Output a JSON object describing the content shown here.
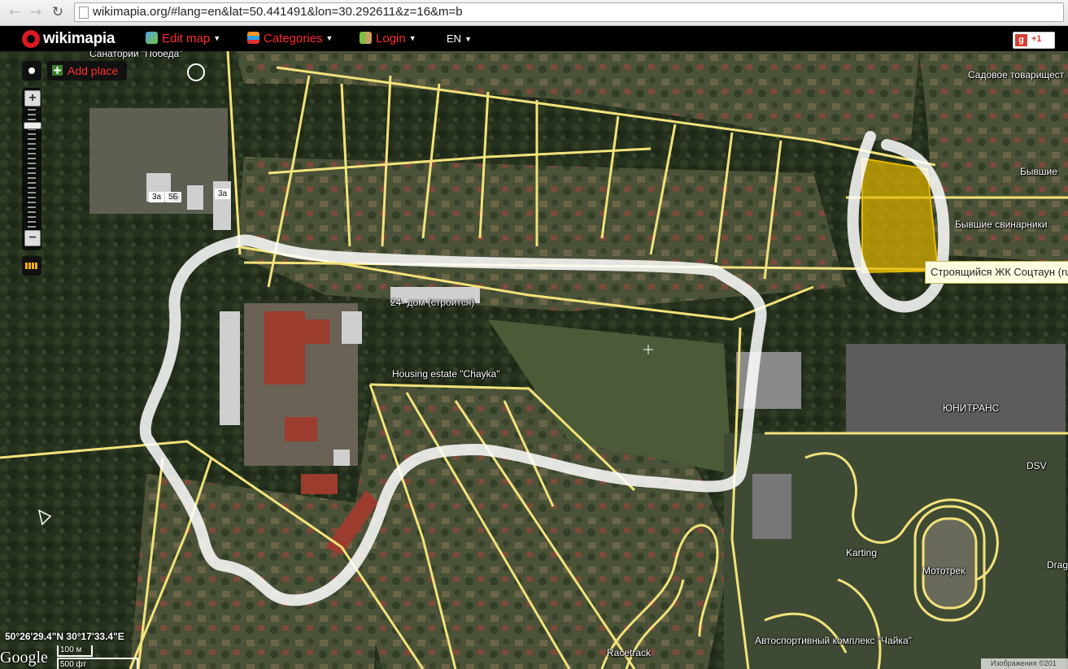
{
  "browser": {
    "url": "wikimapia.org/#lang=en&lat=50.441491&lon=30.292611&z=16&m=b",
    "back_icon": "arrow-left-icon",
    "forward_icon": "arrow-right-icon",
    "reload_icon": "reload-icon"
  },
  "toolbar": {
    "logo_text": "wikimapia",
    "edit_map": "Edit map",
    "categories": "Categories",
    "login": "Login",
    "language": "EN",
    "gplus_g": "g",
    "gplus_count": "+1"
  },
  "controls": {
    "add_place": "Add place",
    "zoom_in": "+",
    "zoom_out": "−",
    "zoom_level": 16
  },
  "map": {
    "labels": {
      "sanatorium": "Санатории \"Победа\"",
      "garden_society": "Садовое товарищест",
      "former_top": "Бывшие ",
      "former_pigsties": "Бывшие свинарники",
      "building_3a_left": "3a",
      "building_5b": "5Б",
      "building_3a_right": "3a",
      "house_24": "24- дом (строится)",
      "housing_estate": "Housing estate \"Chayka\"",
      "unitrans": "ЮНИТРАНС",
      "dsv": "DSV",
      "karting": "Karting",
      "motortrack": "Мототрек",
      "drag": "Drag",
      "racetrack": "Racetrack",
      "autosport_complex": "Автоспортивный комплекс \"Чайка\""
    },
    "hover_label": "Строящийся ЖК Соцтаун (ru",
    "highlight_color": "#e6b800",
    "road_color": "#f2e27a",
    "route_color": "#ffffff"
  },
  "footer": {
    "coordinates": "50°26'29.4\"N 30°17'33.4\"E",
    "google": "Google",
    "scale_top": "100 м",
    "scale_bottom": "500 фт",
    "copyright": "Изображения ©201"
  }
}
